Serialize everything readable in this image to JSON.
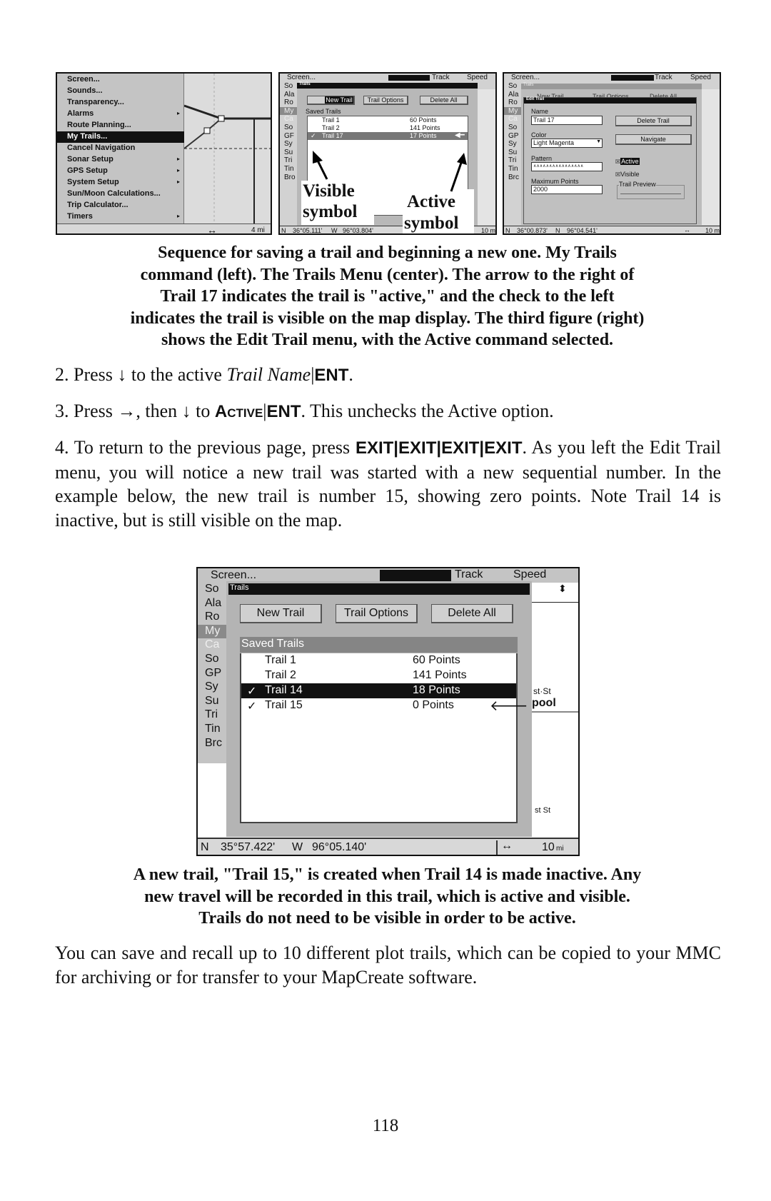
{
  "figure1": {
    "menu_items": [
      "Screen...",
      "Sounds...",
      "Transparency...",
      "Alarms",
      "Route Planning...",
      "My Trails...",
      "Cancel Navigation",
      "Sonar Setup",
      "GPS Setup",
      "System Setup",
      "Sun/Moon Calculations...",
      "Trip Calculator...",
      "Timers"
    ],
    "submenu_flags": [
      false,
      false,
      false,
      true,
      false,
      false,
      false,
      true,
      true,
      true,
      false,
      false,
      true
    ],
    "selected": "My Trails...",
    "scale": "4 mi",
    "zoom_icon": "double-arrow"
  },
  "figure2": {
    "header": {
      "screen": "Screen...",
      "track": "Track",
      "speed": "Speed"
    },
    "menu_stubs": [
      "So",
      "Ala",
      "Ro",
      "My",
      "Ca",
      "So",
      "GF",
      "Sy",
      "Su",
      "Tri",
      "Tin",
      "Bro"
    ],
    "dialog_title": "Trails",
    "buttons": [
      "New Trail",
      "Trail Options",
      "Delete All"
    ],
    "list_header": "Saved Trails",
    "rows": [
      {
        "check": "",
        "name": "Trail 1",
        "points": "60 Points",
        "active": false
      },
      {
        "check": "",
        "name": "Trail 2",
        "points": "141 Points",
        "active": false
      },
      {
        "check": "✓",
        "name": "Trail 17",
        "points": "17 Points",
        "active": true
      }
    ],
    "callout_visible": [
      "Visible",
      "symbol"
    ],
    "callout_active": [
      "Active",
      "symbol"
    ],
    "status": {
      "lat_h": "N",
      "lat": "36°05.111'",
      "lon_h": "W",
      "lon": "96°03.804'",
      "scale": "10 mi"
    }
  },
  "figure3": {
    "header": {
      "screen": "Screen...",
      "track": "Track",
      "speed": "Speed"
    },
    "menu_stubs": [
      "So",
      "Ala",
      "Ro",
      "My",
      "Ca",
      "So",
      "GP",
      "Sy",
      "Su",
      "Tri",
      "Tin",
      "Brc"
    ],
    "back_title": "Trails",
    "back_buttons": [
      "New Trail",
      "Trail Options",
      "Delete All"
    ],
    "dialog_title": "Edit Trail",
    "name_label": "Name",
    "name_value": "Trail 17",
    "color_label": "Color",
    "color_value": "Light Magenta",
    "pattern_label": "Pattern",
    "pattern_value": "∧∧∧∧∧∧∧∧∧∧∧∧∧∧∧∧",
    "max_label": "Maximum Points",
    "max_value": "2000",
    "delete_button": "Delete Trail",
    "navigate_button": "Navigate",
    "active_label": "Active",
    "active_checked": true,
    "visible_label": "Visible",
    "visible_checked": true,
    "preview_label": "Trail Preview",
    "status": {
      "lat_h": "N",
      "lat": "36°00.873'",
      "lon_h": "N",
      "lon": "96°04.541'",
      "scale": "10 mi"
    }
  },
  "caption1": [
    "Sequence for saving a trail and beginning a new one. My Trails",
    "command (left). The Trails Menu (center). The arrow to the right of",
    "Trail 17 indicates the trail is \"active,\" and the check to the left",
    "indicates the trail is visible on the map display. The third figure (right)",
    "shows the Edit Trail menu, with the Active command selected."
  ],
  "step2": {
    "a": "2. Press ↓ to the active ",
    "italic": "Trail Name",
    "sep": "|",
    "key": "ENT",
    "end": "."
  },
  "step3": {
    "a": "3. Press →, then ↓ to ",
    "key1": "Active",
    "sep": "|",
    "key2": "ENT",
    "end": ". This unchecks the Active option."
  },
  "step4": {
    "a": "4. To return to the previous page, press ",
    "keys": "EXIT|EXIT|EXIT|EXIT",
    "b": ". As you left the Edit Trail menu, you will notice a new trail was started with a new sequential number. In the example below, the new trail is number 15, showing zero points. Note Trail 14 is inactive, but is still visible on the map."
  },
  "figure4": {
    "header": {
      "screen": "Screen...",
      "track": "Track",
      "speed": "Speed"
    },
    "menu_stubs": [
      "So",
      "Ala",
      "Ro",
      "My",
      "Ca",
      "So",
      "GP",
      "Sy",
      "Su",
      "Tri",
      "Tin",
      "Brc"
    ],
    "dialog_title": "Trails",
    "buttons": [
      "New Trail",
      "Trail Options",
      "Delete All"
    ],
    "list_header": "Saved Trails",
    "rows": [
      {
        "check": "",
        "name": "Trail 1",
        "points": "60 Points",
        "active": false,
        "selected": false
      },
      {
        "check": "",
        "name": "Trail 2",
        "points": "141 Points",
        "active": false,
        "selected": false
      },
      {
        "check": "✓",
        "name": "Trail 14",
        "points": "18 Points",
        "active": false,
        "selected": true
      },
      {
        "check": "✓",
        "name": "Trail 15",
        "points": "0 Points",
        "active": true,
        "selected": false
      }
    ],
    "map_labels": [
      "st·St",
      "pool",
      "st St"
    ],
    "status": {
      "lat_h": "N",
      "lat": "35°57.422'",
      "lon_h": "W",
      "lon": "96°05.140'",
      "scale": "10",
      "unit": "mi"
    }
  },
  "caption2": [
    "A new trail, \"Trail 15,\" is created when Trail 14 is made inactive. Any",
    "new travel will be recorded in this trail, which is active and visible.",
    "Trails do not need to be visible in order to be active."
  ],
  "closing": "You can save and recall up to 10 different plot trails, which can be copied to your MMC for archiving or for transfer to your MapCreate software.",
  "page_number": "118"
}
